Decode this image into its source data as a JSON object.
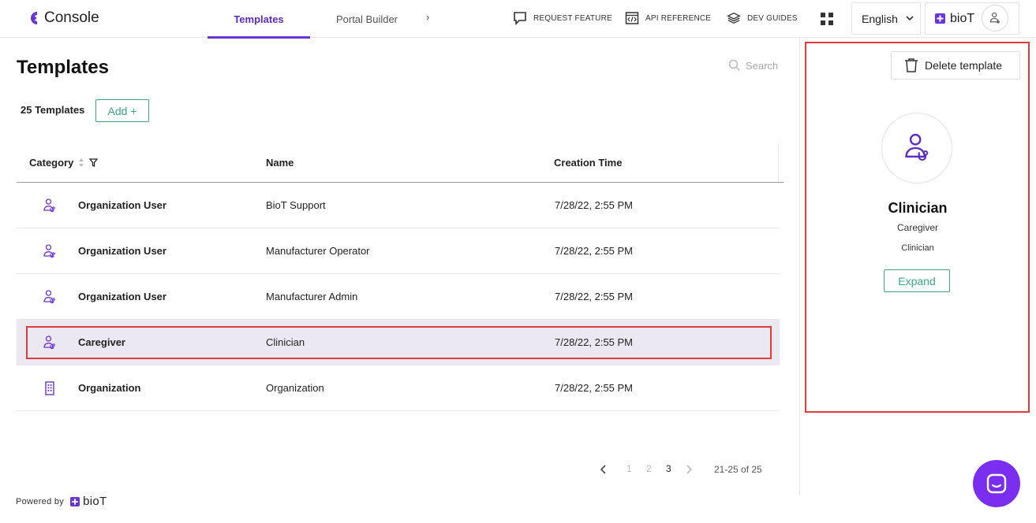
{
  "header": {
    "app_name": "Console",
    "tabs": [
      {
        "label": "Templates",
        "active": true
      },
      {
        "label": "Portal Builder",
        "active": false
      }
    ],
    "more": "›",
    "links": [
      {
        "label": "REQUEST FEATURE",
        "icon": "chat-bubble-icon"
      },
      {
        "label": "API REFERENCE",
        "icon": "code-doc-icon"
      },
      {
        "label": "DEV GUIDES",
        "icon": "layers-icon"
      }
    ],
    "language": "English",
    "brand": "bioT"
  },
  "main": {
    "title": "Templates",
    "search_placeholder": "Search",
    "count_label": "25 Templates",
    "add_label": "Add +",
    "columns": [
      "Category",
      "Name",
      "Creation Time"
    ],
    "rows": [
      {
        "category": "Organization User",
        "name": "BioT Support",
        "time": "7/28/22, 2:55 PM",
        "icon": "user-stethoscope-icon"
      },
      {
        "category": "Organization User",
        "name": "Manufacturer Operator",
        "time": "7/28/22, 2:55 PM",
        "icon": "user-stethoscope-icon"
      },
      {
        "category": "Organization User",
        "name": "Manufacturer Admin",
        "time": "7/28/22, 2:55 PM",
        "icon": "user-stethoscope-icon"
      },
      {
        "category": "Caregiver",
        "name": "Clinician",
        "time": "7/28/22, 2:55 PM",
        "icon": "user-stethoscope-icon",
        "selected": true
      },
      {
        "category": "Organization",
        "name": "Organization",
        "time": "7/28/22, 2:55 PM",
        "icon": "building-icon"
      }
    ],
    "pagination": {
      "pages": [
        "1",
        "2",
        "3"
      ],
      "current": "3",
      "range": "21-25 of 25"
    }
  },
  "footer": {
    "powered_by": "Powered by",
    "brand": "bioT"
  },
  "side_panel": {
    "delete_label": "Delete template",
    "title": "Clinician",
    "subtitle": "Caregiver",
    "detail": "Clinician",
    "expand_label": "Expand"
  },
  "colors": {
    "accent": "#6a35d8",
    "green": "#3aa882",
    "highlight": "#e23b3b",
    "selected_row": "#ece8f1",
    "chat": "#7a2ff0"
  }
}
